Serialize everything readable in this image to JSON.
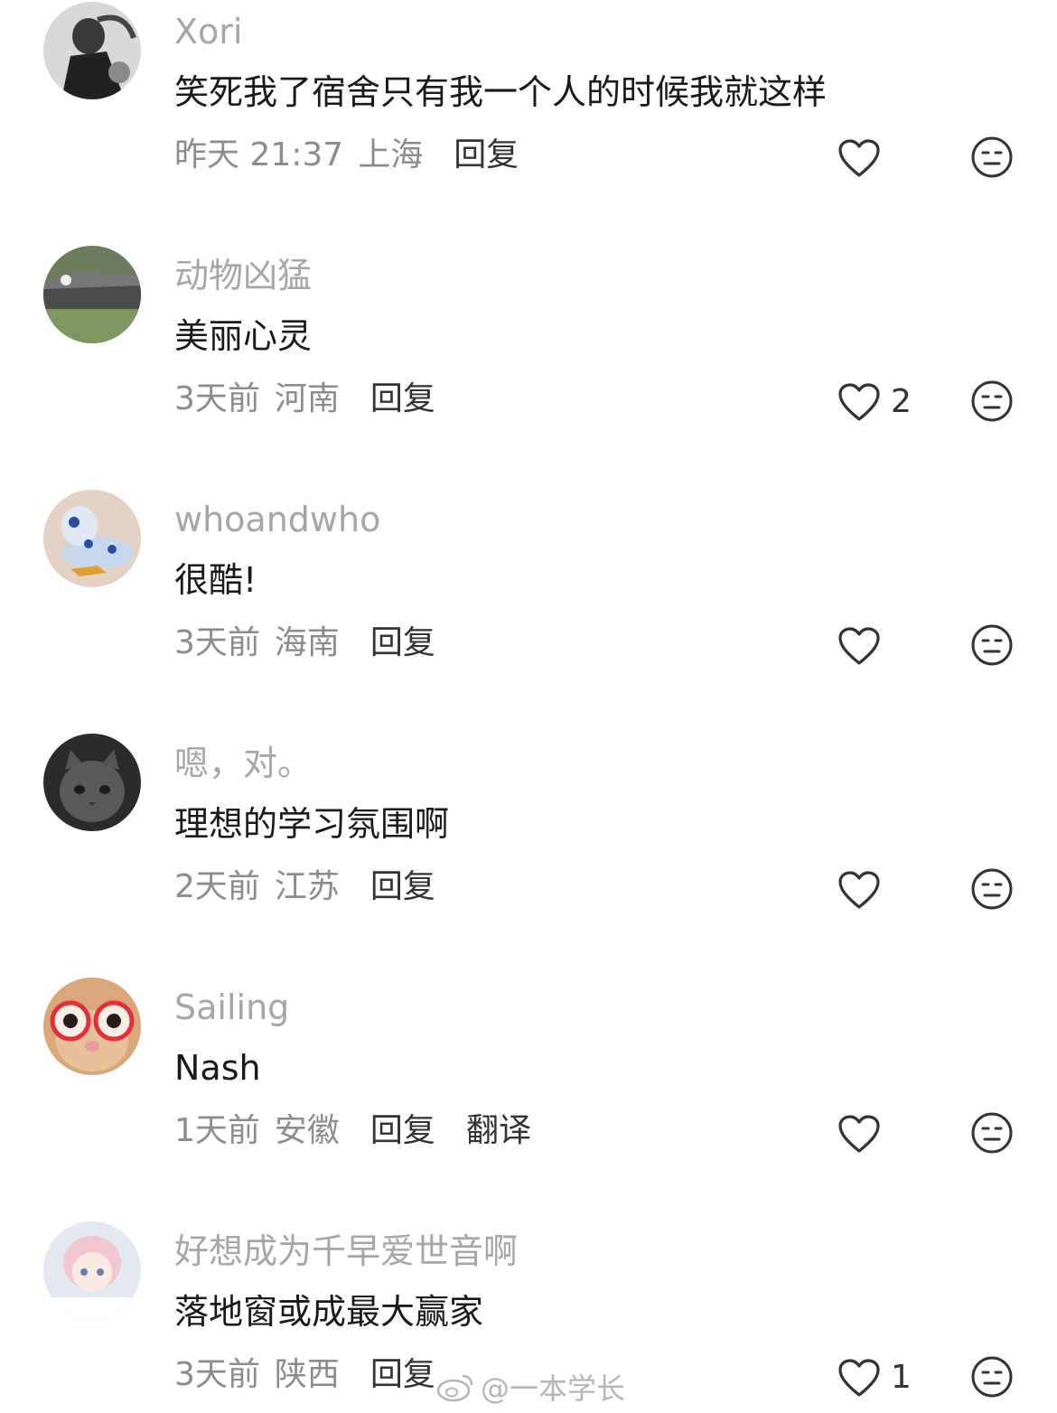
{
  "comments": [
    {
      "username": "Xori",
      "content": "笑死我了宿舍只有我一个人的时候我就这样",
      "time": "昨天 21:37",
      "location": "上海",
      "reply": "回复",
      "likes": ""
    },
    {
      "username": "动物凶猛",
      "content": "美丽心灵",
      "time": "3天前",
      "location": "河南",
      "reply": "回复",
      "likes": "2"
    },
    {
      "username": "whoandwho",
      "content": "很酷!",
      "time": "3天前",
      "location": "海南",
      "reply": "回复",
      "likes": ""
    },
    {
      "username": "嗯，对。",
      "content": "理想的学习氛围啊",
      "time": "2天前",
      "location": "江苏",
      "reply": "回复",
      "likes": ""
    },
    {
      "username": "Sailing",
      "content": "Nash",
      "time": "1天前",
      "location": "安徽",
      "reply": "回复",
      "translate": "翻译",
      "likes": ""
    },
    {
      "username": "好想成为千早爱世音啊",
      "content": "落地窗或成最大赢家",
      "time": "3天前",
      "location": "陕西",
      "reply": "回复",
      "likes": "1"
    }
  ],
  "icons": {
    "like": "heart-outline-icon",
    "dislike": "neutral-face-icon"
  },
  "watermark": {
    "text": "@一本学长"
  }
}
